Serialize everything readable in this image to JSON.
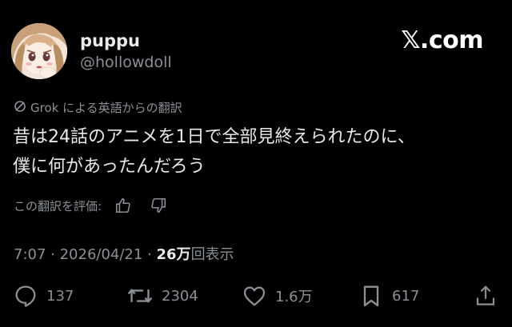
{
  "tweet": {
    "author": {
      "display_name": "puppu",
      "handle": "@hollowdoll"
    },
    "brand": "𝕏.com",
    "translation_label": "Grok による英語からの翻訳",
    "text": "昔は24話のアニメを1日で全部見終えられたのに、\n僕に何があったんだろう",
    "rate_translation_label": "この翻訳を評価:",
    "timestamp": "7:07 · 2026/04/21 · ",
    "views_count": "26万",
    "views_label": "回表示",
    "stats": {
      "replies": "137",
      "reposts": "2304",
      "likes": "1.6万",
      "bookmarks": "617"
    }
  },
  "colors": {
    "background": "#000000",
    "text_primary": "#e7e9ea",
    "text_secondary": "#8b9096"
  },
  "icons": [
    "grok-icon",
    "thumbs-up-icon",
    "thumbs-down-icon",
    "reply-icon",
    "repost-icon",
    "like-icon",
    "bookmark-icon",
    "share-icon"
  ]
}
